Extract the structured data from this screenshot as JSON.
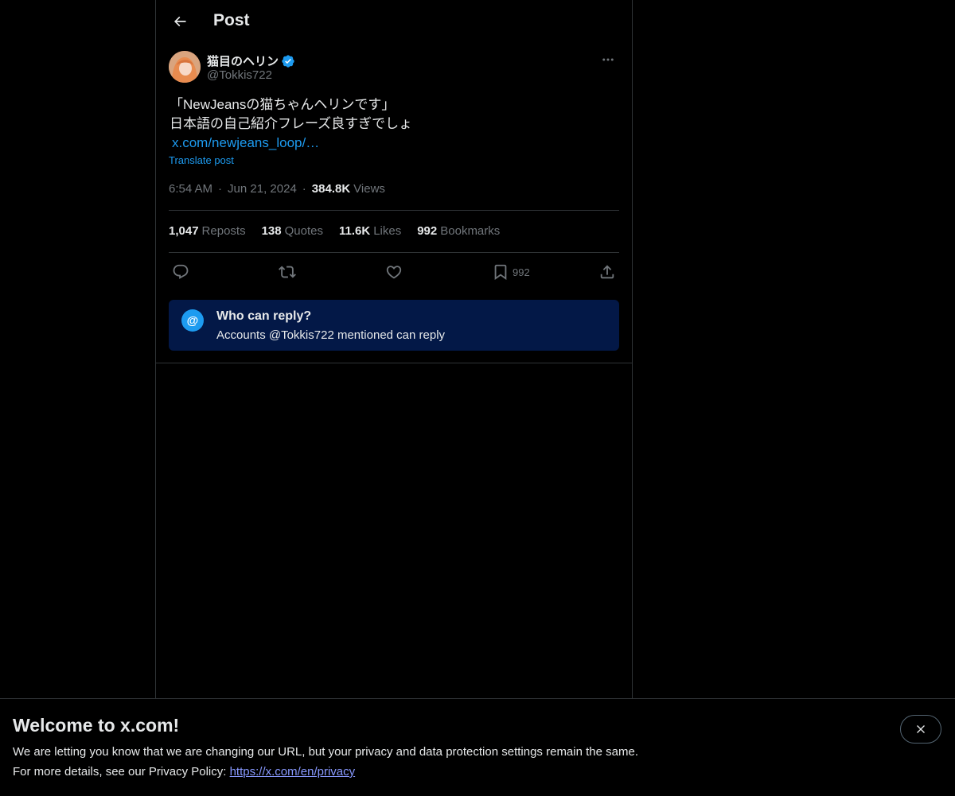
{
  "header": {
    "title": "Post"
  },
  "author": {
    "display_name": "猫目のヘリン",
    "handle": "@Tokkis722"
  },
  "tweet": {
    "lines": [
      "「NewJeansの猫ちゃんヘリンです」",
      "日本語の自己紹介フレーズ良すぎでしょ"
    ],
    "link": "x.com/newjeans_loop/…",
    "translate_label": "Translate post",
    "time": "6:54 AM",
    "date": "Jun 21, 2024",
    "views_count": "384.8K",
    "views_label": "Views",
    "separator": "·"
  },
  "stats": [
    {
      "count": "1,047",
      "label": "Reposts"
    },
    {
      "count": "138",
      "label": "Quotes"
    },
    {
      "count": "11.6K",
      "label": "Likes"
    },
    {
      "count": "992",
      "label": "Bookmarks"
    }
  ],
  "actions": {
    "bookmark_count": "992"
  },
  "reply_settings": {
    "icon_glyph": "@",
    "title": "Who can reply?",
    "subtitle": "Accounts @Tokkis722 mentioned can reply"
  },
  "banner": {
    "title": "Welcome to x.com!",
    "line1": "We are letting you know that we are changing our URL, but your privacy and data protection settings remain the same.",
    "line2_prefix": "For more details, see our Privacy Policy: ",
    "link": "https://x.com/en/privacy"
  },
  "colors": {
    "background": "#000000",
    "text": "#e7e9ea",
    "muted": "#71767b",
    "accent": "#1d9bf0",
    "reply_box": "#031847",
    "border": "#2f3336"
  },
  "icons": [
    "back-arrow-icon",
    "verified-badge-icon",
    "more-icon",
    "reply-icon",
    "repost-icon",
    "like-icon",
    "bookmark-icon",
    "share-icon",
    "at-sign-icon",
    "close-icon"
  ]
}
